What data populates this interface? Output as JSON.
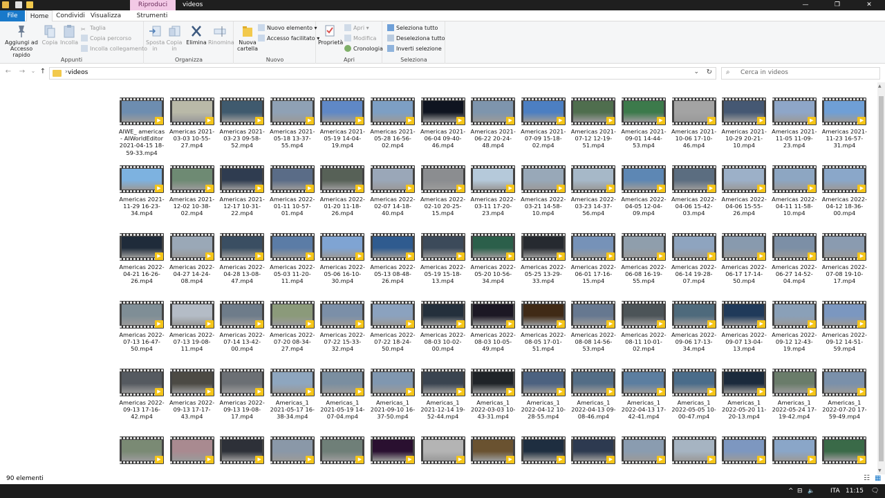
{
  "window": {
    "title": "videos",
    "context_tab": "Riproduci",
    "minimize_glyph": "—",
    "maximize_glyph": "❐",
    "close_glyph": "✕"
  },
  "ribbon_tabs": {
    "file": "File",
    "home": "Home",
    "share": "Condividi",
    "view": "Visualizza",
    "video": "Strumenti video"
  },
  "ribbon": {
    "appunti": {
      "label": "Appunti",
      "pin": "Aggiungi ad Accesso rapido",
      "copy": "Copia",
      "paste": "Incolla",
      "cut": "Taglia",
      "copy_path": "Copia percorso",
      "paste_link": "Incolla collegamento"
    },
    "organizza": {
      "label": "Organizza",
      "move": "Sposta in",
      "copy_to": "Copia in",
      "delete": "Elimina",
      "rename": "Rinomina"
    },
    "nuovo": {
      "label": "Nuovo",
      "new_folder": "Nuova cartella",
      "new_item": "Nuovo elemento ▾",
      "easy_access": "Accesso facilitato ▾"
    },
    "apri": {
      "label": "Apri",
      "properties": "Proprietà",
      "open": "Apri ▾",
      "edit": "Modifica",
      "history": "Cronologia"
    },
    "seleziona": {
      "label": "Seleziona",
      "select_all": "Seleziona tutto",
      "select_none": "Deseleziona tutto",
      "invert": "Inverti selezione"
    }
  },
  "nav": {
    "back_glyph": "←",
    "forward_glyph": "→",
    "recent_glyph": "⌄",
    "up_glyph": "↑",
    "address_chevron": "›",
    "address": "videos",
    "dropdown_glyph": "⌄",
    "refresh_glyph": "↻",
    "search_glyph": "⌕",
    "search_placeholder": "Cerca in videos"
  },
  "files": [
    "AIWE_ americas - AIWorldEditor 2021-04-15 18-59-33.mp4",
    "Americas 2021-03-03 10-55-27.mp4",
    "Americas 2021-03-23 09-58-52.mp4",
    "Americas 2021-05-18 13-37-55.mp4",
    "Americas 2021-05-19 14-04-19.mp4",
    "Americas 2021-05-28 16-56-02.mp4",
    "Americas 2021-06-04 09-40-46.mp4",
    "Americas 2021-06-22 20-24-48.mp4",
    "Americas 2021-07-09 15-18-02.mp4",
    "Americas 2021-07-12 12-19-51.mp4",
    "Americas 2021-09-01 14-44-53.mp4",
    "Americas 2021-10-06 17-10-46.mp4",
    "Americas 2021-10-29 20-21-10.mp4",
    "Americas 2021-11-05 11-09-23.mp4",
    "Americas 2021-11-23 16-57-31.mp4",
    "Americas 2021-11-29 16-23-34.mp4",
    "Americas 2021-12-02 10-38-02.mp4",
    "Americas 2021-12-17 10-31-22.mp4",
    "Americas 2022-01-11 10-57-01.mp4",
    "Americas 2022-01-20 11-18-26.mp4",
    "Americas 2022-02-07 14-18-40.mp4",
    "Americas 2022-02-10 20-25-15.mp4",
    "Americas 2022-03-11 17-20-23.mp4",
    "Americas 2022-03-21 14-58-10.mp4",
    "Americas 2022-03-23 14-37-56.mp4",
    "Americas 2022-04-05 12-04-09.mp4",
    "Americas 2022-04-06 15-42-03.mp4",
    "Americas 2022-04-06 15-55-26.mp4",
    "Americas 2022-04-11 11-58-10.mp4",
    "Americas 2022-04-12 18-36-00.mp4",
    "Americas 2022-04-21 16-26-26.mp4",
    "Americas 2022-04-27 14-24-08.mp4",
    "Americas 2022-04-28 13-08-47.mp4",
    "Americas 2022-05-03 11-20-11.mp4",
    "Americas 2022-05-06 16-10-30.mp4",
    "Americas 2022-05-13 08-48-26.mp4",
    "Americas 2022-05-19 15-18-13.mp4",
    "Americas 2022-05-20 10-56-34.mp4",
    "Americas 2022-05-25 13-29-33.mp4",
    "Americas 2022-06-01 17-16-15.mp4",
    "Americas 2022-06-08 16-19-55.mp4",
    "Americas 2022-06-14 19-28-07.mp4",
    "Americas 2022-06-17 17-14-50.mp4",
    "Americas 2022-06-27 14-52-04.mp4",
    "Americas 2022-07-08 19-10-17.mp4",
    "Americas 2022-07-13 16-47-50.mp4",
    "Americas 2022-07-13 19-08-11.mp4",
    "Americas 2022-07-14 13-42-00.mp4",
    "Americas 2022-07-20 08-34-27.mp4",
    "Americas 2022-07-22 15-33-32.mp4",
    "Americas 2022-07-22 18-24-50.mp4",
    "Americas 2022-08-03 10-02-00.mp4",
    "Americas 2022-08-03 10-05-49.mp4",
    "Americas 2022-08-05 17-01-51.mp4",
    "Americas 2022-08-08 14-56-53.mp4",
    "Americas 2022-08-11 10-01-02.mp4",
    "Americas 2022-09-06 17-13-34.mp4",
    "Americas 2022-09-07 13-04-13.mp4",
    "Americas 2022-09-12 12-43-19.mp4",
    "Americas 2022-09-12 14-51-59.mp4",
    "Americas 2022-09-13 17-16-42.mp4",
    "Americas 2022-09-13 17-17-43.mp4",
    "Americas 2022-09-13 19-08-17.mp4",
    "Americas_1 2021-05-17 16-38-34.mp4",
    "Americas_1 2021-05-19 14-07-04.mp4",
    "Americas_1 2021-09-10 16-37-50.mp4",
    "Americas_1 2021-12-14 19-52-44.mp4",
    "Americas_1 2022-03-03 10-43-31.mp4",
    "Americas_1 2022-04-12 10-28-55.mp4",
    "Americas_1 2022-04-13 09-08-46.mp4",
    "Americas_1 2022-04-13 17-42-41.mp4",
    "Americas_1 2022-05-05 10-00-47.mp4",
    "Americas_1 2022-05-20 11-20-13.mp4",
    "Americas_1 2022-05-24 17-19-42.mp4",
    "Americas_1 2022-07-20 17-59-49.mp4"
  ],
  "thumb_colors": [
    "#6d8db0",
    "#b9b9a8",
    "#3f5a6e",
    "#8fa1b5",
    "#5f88c6",
    "#7d9fc4",
    "#0f1420",
    "#7e95ad",
    "#4c7fc2",
    "#4f6e4e",
    "#3c7a4b",
    "#a3a3a3",
    "#455873",
    "#8ea6c8",
    "#6f9fd6",
    "#7db2e0",
    "#6e8a73",
    "#2f3c50",
    "#5a6c87",
    "#576157",
    "#9aa7b8",
    "#8b8d90",
    "#b5c9da",
    "#98a8b8",
    "#a6b8c8",
    "#5d87b4",
    "#5b6d80",
    "#9cb0c8",
    "#8da6c2",
    "#8aa7c9",
    "#1f2b3a",
    "#9aa8b7",
    "#3a4e62",
    "#5b7ca6",
    "#7fa4d3",
    "#2f5b8f",
    "#3c4a5a",
    "#2b5f4a",
    "#262a30",
    "#7692b8",
    "#8f9eac",
    "#8ea4bf",
    "#889aae",
    "#7c8fa6",
    "#8a9bb0",
    "#7f8e96",
    "#b4bcc6",
    "#6e7c8a",
    "#8b9a7a",
    "#7b8fa8",
    "#8ba2bf",
    "#24303c",
    "#1c1824",
    "#402a16",
    "#667890",
    "#4c5458",
    "#4e6a7c",
    "#203a5a",
    "#8aa0b8",
    "#7b97c0",
    "#555a60",
    "#4c4a44",
    "#6b6f74",
    "#8ea6bf",
    "#7a8ea0",
    "#8097b0",
    "#3a4450",
    "#202428",
    "#4c6280",
    "#536d86",
    "#5c7ea0",
    "#4a6c8a",
    "#1b2a3c",
    "#6a7c6a",
    "#7a90aa"
  ],
  "partial_row_colors": [
    "#7a8a74",
    "#a98a90",
    "#2d3038",
    "#8a98a8",
    "#6f7f78",
    "#2a1030",
    "#b4b4b4",
    "#6a5230",
    "#1e2e40",
    "#2d3a50",
    "#8a9cb0",
    "#a6b4c2",
    "#7d97c0",
    "#8aa6c8",
    "#3a6a48"
  ],
  "badge_glyph": "▶",
  "scrollbar": {
    "up_glyph": "▲",
    "down_glyph": "▼"
  },
  "status": {
    "count": "90 elementi",
    "details_view_glyph": "☷",
    "large_icons_glyph": "▦"
  },
  "taskbar": {
    "chevron": "^",
    "network": "⊟",
    "volume": "🔈",
    "language": "ITA",
    "time": "11:15",
    "notification": "🗨"
  }
}
